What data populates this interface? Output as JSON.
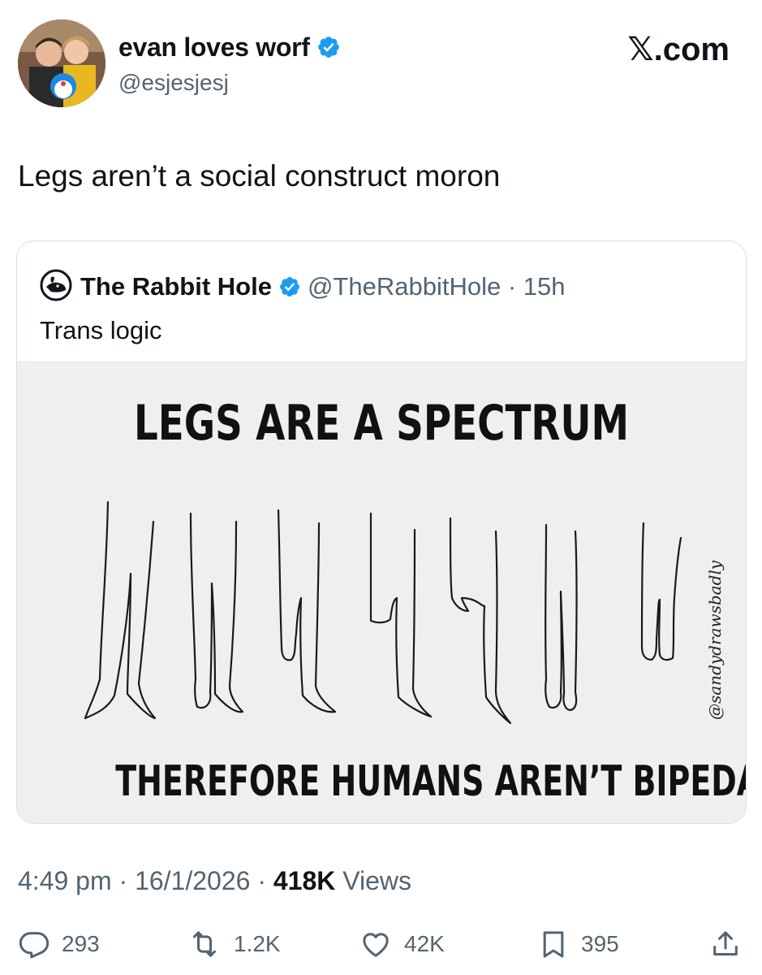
{
  "author": {
    "display_name": "evan loves worf",
    "handle": "@esjesjesj",
    "avatar_alt": "profile photo"
  },
  "site_logo": "𝕏.com",
  "tweet": {
    "text": "Legs aren’t a social construct moron"
  },
  "quoted_tweet": {
    "display_name": "The Rabbit Hole",
    "handle": "@TheRabbitHole",
    "separator": " · ",
    "age": "15h",
    "text": "Trans logic",
    "media": {
      "title": "LEGS ARE A SPECTRUM",
      "caption": "THEREFORE HUMANS AREN’T BIPEDAL",
      "watermark": "@sandydrawsbadly"
    }
  },
  "meta": {
    "time": "4:49 pm",
    "date": "16/1/2026",
    "views_count": "418K",
    "views_label": "Views",
    "dot": " · "
  },
  "actions": {
    "replies": "293",
    "reposts": "1.2K",
    "likes": "42K",
    "bookmarks": "395"
  },
  "colors": {
    "text": "#0f1419",
    "secondary": "#536471",
    "verified": "#1d9bf0",
    "border": "#d8dee3",
    "media_bg": "#efefef"
  },
  "icons": [
    "verified-badge-icon",
    "reply-icon",
    "repost-icon",
    "like-icon",
    "bookmark-icon",
    "share-icon"
  ]
}
